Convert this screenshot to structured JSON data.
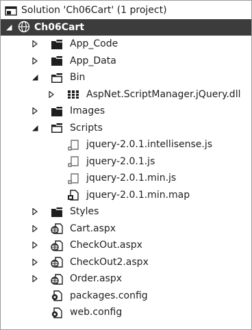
{
  "tree": {
    "solution_label": "Solution 'Ch06Cart' (1 project)",
    "project_label": "Ch06Cart",
    "items": [
      {
        "label": "App_Code",
        "icon": "folder-icon"
      },
      {
        "label": "App_Data",
        "icon": "folder-icon"
      },
      {
        "label": "Bin",
        "icon": "folder-open-icon"
      },
      {
        "label": "AspNet.ScriptManager.jQuery.dll",
        "icon": "assembly-icon"
      },
      {
        "label": "Images",
        "icon": "folder-icon"
      },
      {
        "label": "Scripts",
        "icon": "folder-open-icon"
      },
      {
        "label": "jquery-2.0.1.intellisense.js",
        "icon": "js-file-icon"
      },
      {
        "label": "jquery-2.0.1.js",
        "icon": "js-file-icon"
      },
      {
        "label": "jquery-2.0.1.min.js",
        "icon": "js-file-icon"
      },
      {
        "label": "jquery-2.0.1.min.map",
        "icon": "map-file-icon"
      },
      {
        "label": "Styles",
        "icon": "folder-icon"
      },
      {
        "label": "Cart.aspx",
        "icon": "aspx-file-icon"
      },
      {
        "label": "CheckOut.aspx",
        "icon": "aspx-file-icon"
      },
      {
        "label": "CheckOut2.aspx",
        "icon": "aspx-file-icon"
      },
      {
        "label": "Order.aspx",
        "icon": "aspx-file-icon"
      },
      {
        "label": "packages.config",
        "icon": "config-file-icon"
      },
      {
        "label": "web.config",
        "icon": "config-file-icon"
      }
    ]
  }
}
